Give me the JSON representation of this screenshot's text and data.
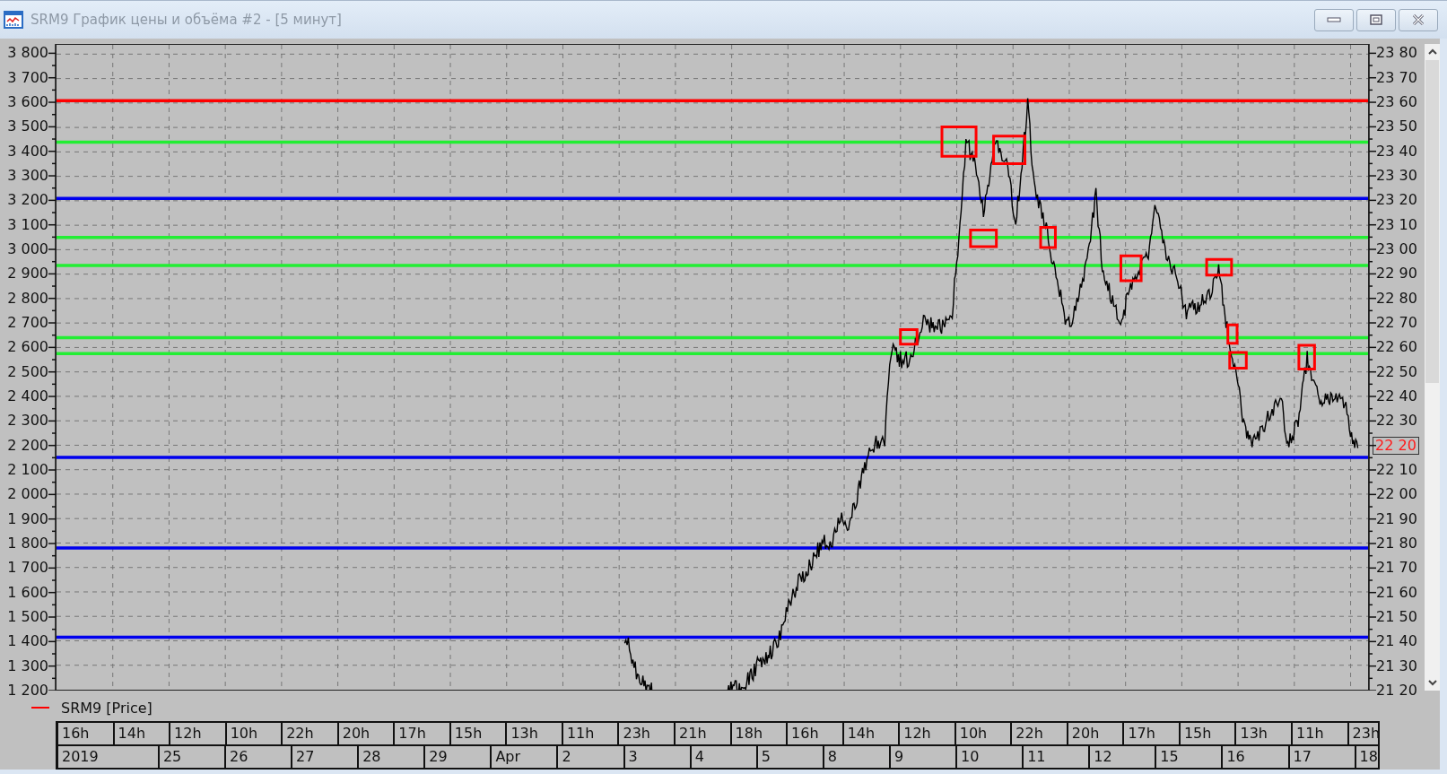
{
  "window": {
    "title": "SRM9 График цены и объёма #2 - [5 минут]"
  },
  "chart": {
    "left_axis": [
      "3 800",
      "3 700",
      "3 600",
      "3 500",
      "3 400",
      "3 300",
      "3 200",
      "3 100",
      "3 000",
      "2 900",
      "2 800",
      "2 700",
      "2 600",
      "2 500",
      "2 400",
      "2 300",
      "2 200",
      "2 100",
      "2 000",
      "1 900",
      "1 800",
      "1 700",
      "1 600",
      "1 500",
      "1 400",
      "1 300",
      "1 200"
    ],
    "right_axis": [
      {
        "text": "23 80",
        "kind": "tick"
      },
      {
        "text": "23 70",
        "kind": "tick"
      },
      {
        "text": "23 60",
        "kind": "tick"
      },
      {
        "text": "23 50",
        "kind": "tick"
      },
      {
        "text": "23 40",
        "kind": "tick"
      },
      {
        "text": "23 30",
        "kind": "tick"
      },
      {
        "text": "23 20",
        "kind": "tick"
      },
      {
        "text": "23 10",
        "kind": "tick"
      },
      {
        "text": "23 00",
        "kind": "tick"
      },
      {
        "text": "22 90",
        "kind": "tick"
      },
      {
        "text": "22 80",
        "kind": "tick"
      },
      {
        "text": "22 70",
        "kind": "tick"
      },
      {
        "text": "22 60",
        "kind": "tick"
      },
      {
        "text": "22 50",
        "kind": "tick"
      },
      {
        "text": "22 40",
        "kind": "tick"
      },
      {
        "text": "22 30",
        "kind": "tick"
      },
      {
        "text": "22 20",
        "kind": "current"
      },
      {
        "text": "22 10",
        "kind": "tick"
      },
      {
        "text": "22 00",
        "kind": "tick"
      },
      {
        "text": "21 90",
        "kind": "tick"
      },
      {
        "text": "21 80",
        "kind": "tick"
      },
      {
        "text": "21 70",
        "kind": "tick"
      },
      {
        "text": "21 60",
        "kind": "tick"
      },
      {
        "text": "21 50",
        "kind": "tick"
      },
      {
        "text": "21 40",
        "kind": "tick"
      },
      {
        "text": "21 30",
        "kind": "tick"
      },
      {
        "text": "21 20",
        "kind": "tick"
      }
    ]
  },
  "legend": [
    {
      "label": "SRM9 [Price]",
      "color": "#ff0000"
    }
  ],
  "time_axis": {
    "hours": [
      "16h",
      "14h",
      "12h",
      "10h",
      "22h",
      "20h",
      "17h",
      "15h",
      "13h",
      "11h",
      "23h",
      "21h",
      "18h",
      "16h",
      "14h",
      "12h",
      "10h",
      "22h",
      "20h",
      "17h",
      "15h",
      "13h",
      "11h",
      "23h"
    ],
    "dates": [
      "2019",
      "25",
      "26",
      "27",
      "28",
      "29",
      "Apr",
      "2",
      "3",
      "4",
      "5",
      "8",
      "9",
      "10",
      "11",
      "12",
      "15",
      "16",
      "17",
      "18"
    ]
  }
}
